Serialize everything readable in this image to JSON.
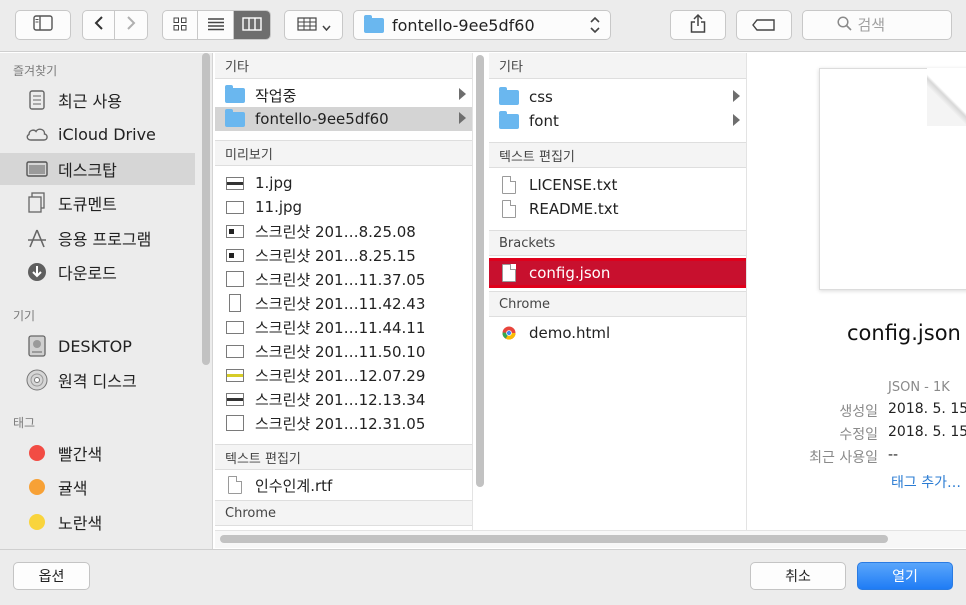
{
  "toolbar": {
    "path_label": "fontello-9ee5df60",
    "search_placeholder": "검색"
  },
  "sidebar": {
    "sections": [
      {
        "label": "즐겨찾기"
      },
      {
        "label": "기기"
      },
      {
        "label": "태그"
      }
    ],
    "favorites": [
      {
        "label": "최근 사용",
        "icon": "recents-icon"
      },
      {
        "label": "iCloud Drive",
        "icon": "cloud-icon"
      },
      {
        "label": "데스크탑",
        "icon": "desktop-icon",
        "selected": true
      },
      {
        "label": "도큐멘트",
        "icon": "documents-icon"
      },
      {
        "label": "응용 프로그램",
        "icon": "applications-icon"
      },
      {
        "label": "다운로드",
        "icon": "downloads-icon"
      }
    ],
    "devices": [
      {
        "label": "DESKTOP",
        "icon": "hard-drive-icon"
      },
      {
        "label": "원격 디스크",
        "icon": "remote-disc-icon"
      }
    ],
    "tags": [
      {
        "label": "빨간색",
        "color": "#f24c44"
      },
      {
        "label": "귤색",
        "color": "#f7a136"
      },
      {
        "label": "노란색",
        "color": "#f9d43c"
      }
    ]
  },
  "column1": {
    "sections": [
      "기타",
      "미리보기",
      "텍스트 편집기",
      "Chrome"
    ],
    "other": [
      {
        "label": "작업중"
      },
      {
        "label": "fontello-9ee5df60"
      }
    ],
    "preview_files": [
      {
        "label": "1.jpg"
      },
      {
        "label": "11.jpg"
      },
      {
        "label": "스크린샷 201…8.25.08"
      },
      {
        "label": "스크린샷 201…8.25.15"
      },
      {
        "label": "스크린샷 201…11.37.05"
      },
      {
        "label": "스크린샷 201…11.42.43"
      },
      {
        "label": "스크린샷 201…11.44.11"
      },
      {
        "label": "스크린샷 201…11.50.10"
      },
      {
        "label": "스크린샷 201…12.07.29"
      },
      {
        "label": "스크린샷 201…12.13.34"
      },
      {
        "label": "스크린샷 201…12.31.05"
      }
    ],
    "text_files": [
      {
        "label": "인수인계.rtf"
      }
    ]
  },
  "column2": {
    "sections": [
      "기타",
      "텍스트 편집기",
      "Brackets",
      "Chrome"
    ],
    "folders": [
      {
        "label": "css"
      },
      {
        "label": "font"
      }
    ],
    "text_files": [
      {
        "label": "LICENSE.txt"
      },
      {
        "label": "README.txt"
      }
    ],
    "brackets_files": [
      {
        "label": "config.json"
      }
    ],
    "chrome_files": [
      {
        "label": "demo.html"
      }
    ]
  },
  "preview": {
    "filename": "config.json",
    "kind": "JSON - 1K",
    "created_label": "생성일",
    "created_value": "2018. 5. 15",
    "modified_label": "수정일",
    "modified_value": "2018. 5. 15",
    "last_used_label": "최근 사용일",
    "last_used_value": "--",
    "add_tags": "태그 추가…"
  },
  "bottom": {
    "options_label": "옵션",
    "cancel_label": "취소",
    "open_label": "열기"
  }
}
